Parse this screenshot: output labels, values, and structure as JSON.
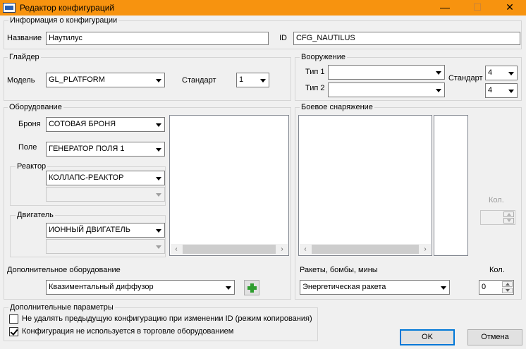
{
  "window": {
    "title": "Редактор конфигураций",
    "min_glyph": "—",
    "max_glyph": "☐",
    "close_glyph": "✕",
    "app_icon": "app-window-icon"
  },
  "config_info": {
    "legend": "Информация о конфигурации",
    "name_label": "Название",
    "name_value": "Наутилус",
    "id_label": "ID",
    "id_value": "CFG_NAUTILUS"
  },
  "glider": {
    "legend": "Глайдер",
    "model_label": "Модель",
    "model_value": "GL_PLATFORM",
    "standard_label": "Стандарт",
    "standard_value": "1"
  },
  "weapons": {
    "legend": "Вооружение",
    "type1_label": "Тип 1",
    "type1_value": "",
    "type2_label": "Тип 2",
    "type2_value": "",
    "standard_label": "Стандарт",
    "standard1_value": "4",
    "standard2_value": "4"
  },
  "equipment": {
    "legend": "Оборудование",
    "armor_label": "Броня",
    "armor_value": "СОТОВАЯ БРОНЯ",
    "field_label": "Поле",
    "field_value": "ГЕНЕРАТОР ПОЛЯ 1",
    "reactor_legend": "Реактор",
    "reactor_value": "КОЛЛАПС-РЕАКТОР",
    "reactor_secondary": "",
    "engine_legend": "Двигатель",
    "engine_value": "ИОННЫЙ ДВИГАТЕЛЬ",
    "engine_secondary": "",
    "additional_label": "Дополнительное оборудование",
    "additional_value": "Квазиментальный диффузор"
  },
  "ammo": {
    "legend": "Боевое снаряжение",
    "qty_label_disabled": "Кол.",
    "qty_disabled_value": "",
    "missiles_label": "Ракеты, бомбы, мины",
    "qty_label": "Кол.",
    "missile_value": "Энергетическая ракета",
    "qty_value": "0"
  },
  "extra": {
    "legend": "Дополнительные параметры",
    "opt1_label": "Не удалять предыдущую конфигурацию при изменении ID  (режим копирования)",
    "opt1_checked": false,
    "opt2_label": "Конфигурация не используется в торговле оборудованием",
    "opt2_checked": true
  },
  "buttons": {
    "ok": "OK",
    "cancel": "Отмена"
  },
  "scroll": {
    "left": "‹",
    "right": "›"
  },
  "colors": {
    "titlebar": "#f7930f",
    "accent": "#0078d7"
  }
}
